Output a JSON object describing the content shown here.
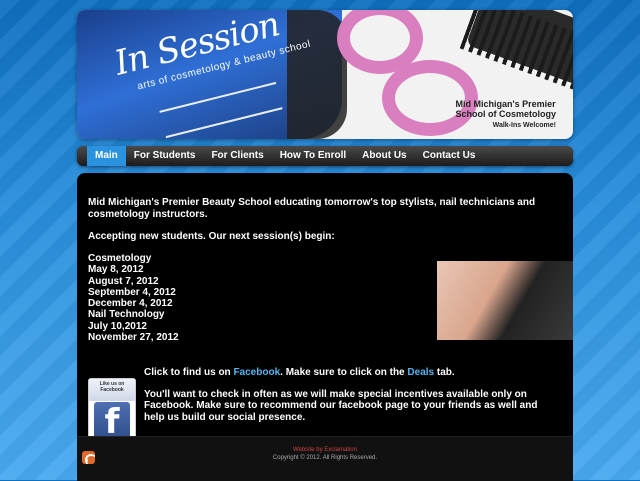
{
  "banner": {
    "logo_title": "In Session",
    "logo_subtitle": "arts of cosmetology & beauty school",
    "heading_line1": "Mid Michigan's Premier",
    "heading_line2": "School of Cosmetology",
    "tagline": "Walk-Ins Welcome!"
  },
  "nav": {
    "items": [
      {
        "label": "Main",
        "active": true
      },
      {
        "label": "For Students",
        "active": false
      },
      {
        "label": "For Clients",
        "active": false
      },
      {
        "label": "How To Enroll",
        "active": false
      },
      {
        "label": "About Us",
        "active": false
      },
      {
        "label": "Contact Us",
        "active": false
      }
    ]
  },
  "content": {
    "intro": "Mid Michigan's Premier Beauty School educating tomorrow's top stylists, nail technicians and cosmetology instructors.",
    "accepting": "Accepting new students. Our next session(s) begin:",
    "sessions": [
      "Cosmetology",
      "May 8, 2012",
      "August 7, 2012",
      "September 4, 2012",
      "December 4, 2012",
      "Nail Technology",
      "July 10,2012",
      "November 27, 2012"
    ],
    "fb_line_prefix": "Click  to find us on ",
    "fb_link": "Facebook",
    "fb_line_mid": ". Make sure to click on the ",
    "deals_link": "Deals",
    "fb_line_suffix": " tab.",
    "fb_paragraph": "You'll want to check in often as we will make special incentives  available only on Facebook. Make sure to recommend our facebook  page to your friends as well and help us build our social presence.",
    "fb_badge_text": "Like us on Facebook",
    "fb_badge_letter": "f"
  },
  "footer": {
    "credit": "Website by Exclamation",
    "copyright": "Copyright © 2012. All Rights Reserved."
  },
  "colors": {
    "nav_active": "#2b92e0",
    "link": "#58b4f0",
    "background": "#2a8fdc"
  }
}
